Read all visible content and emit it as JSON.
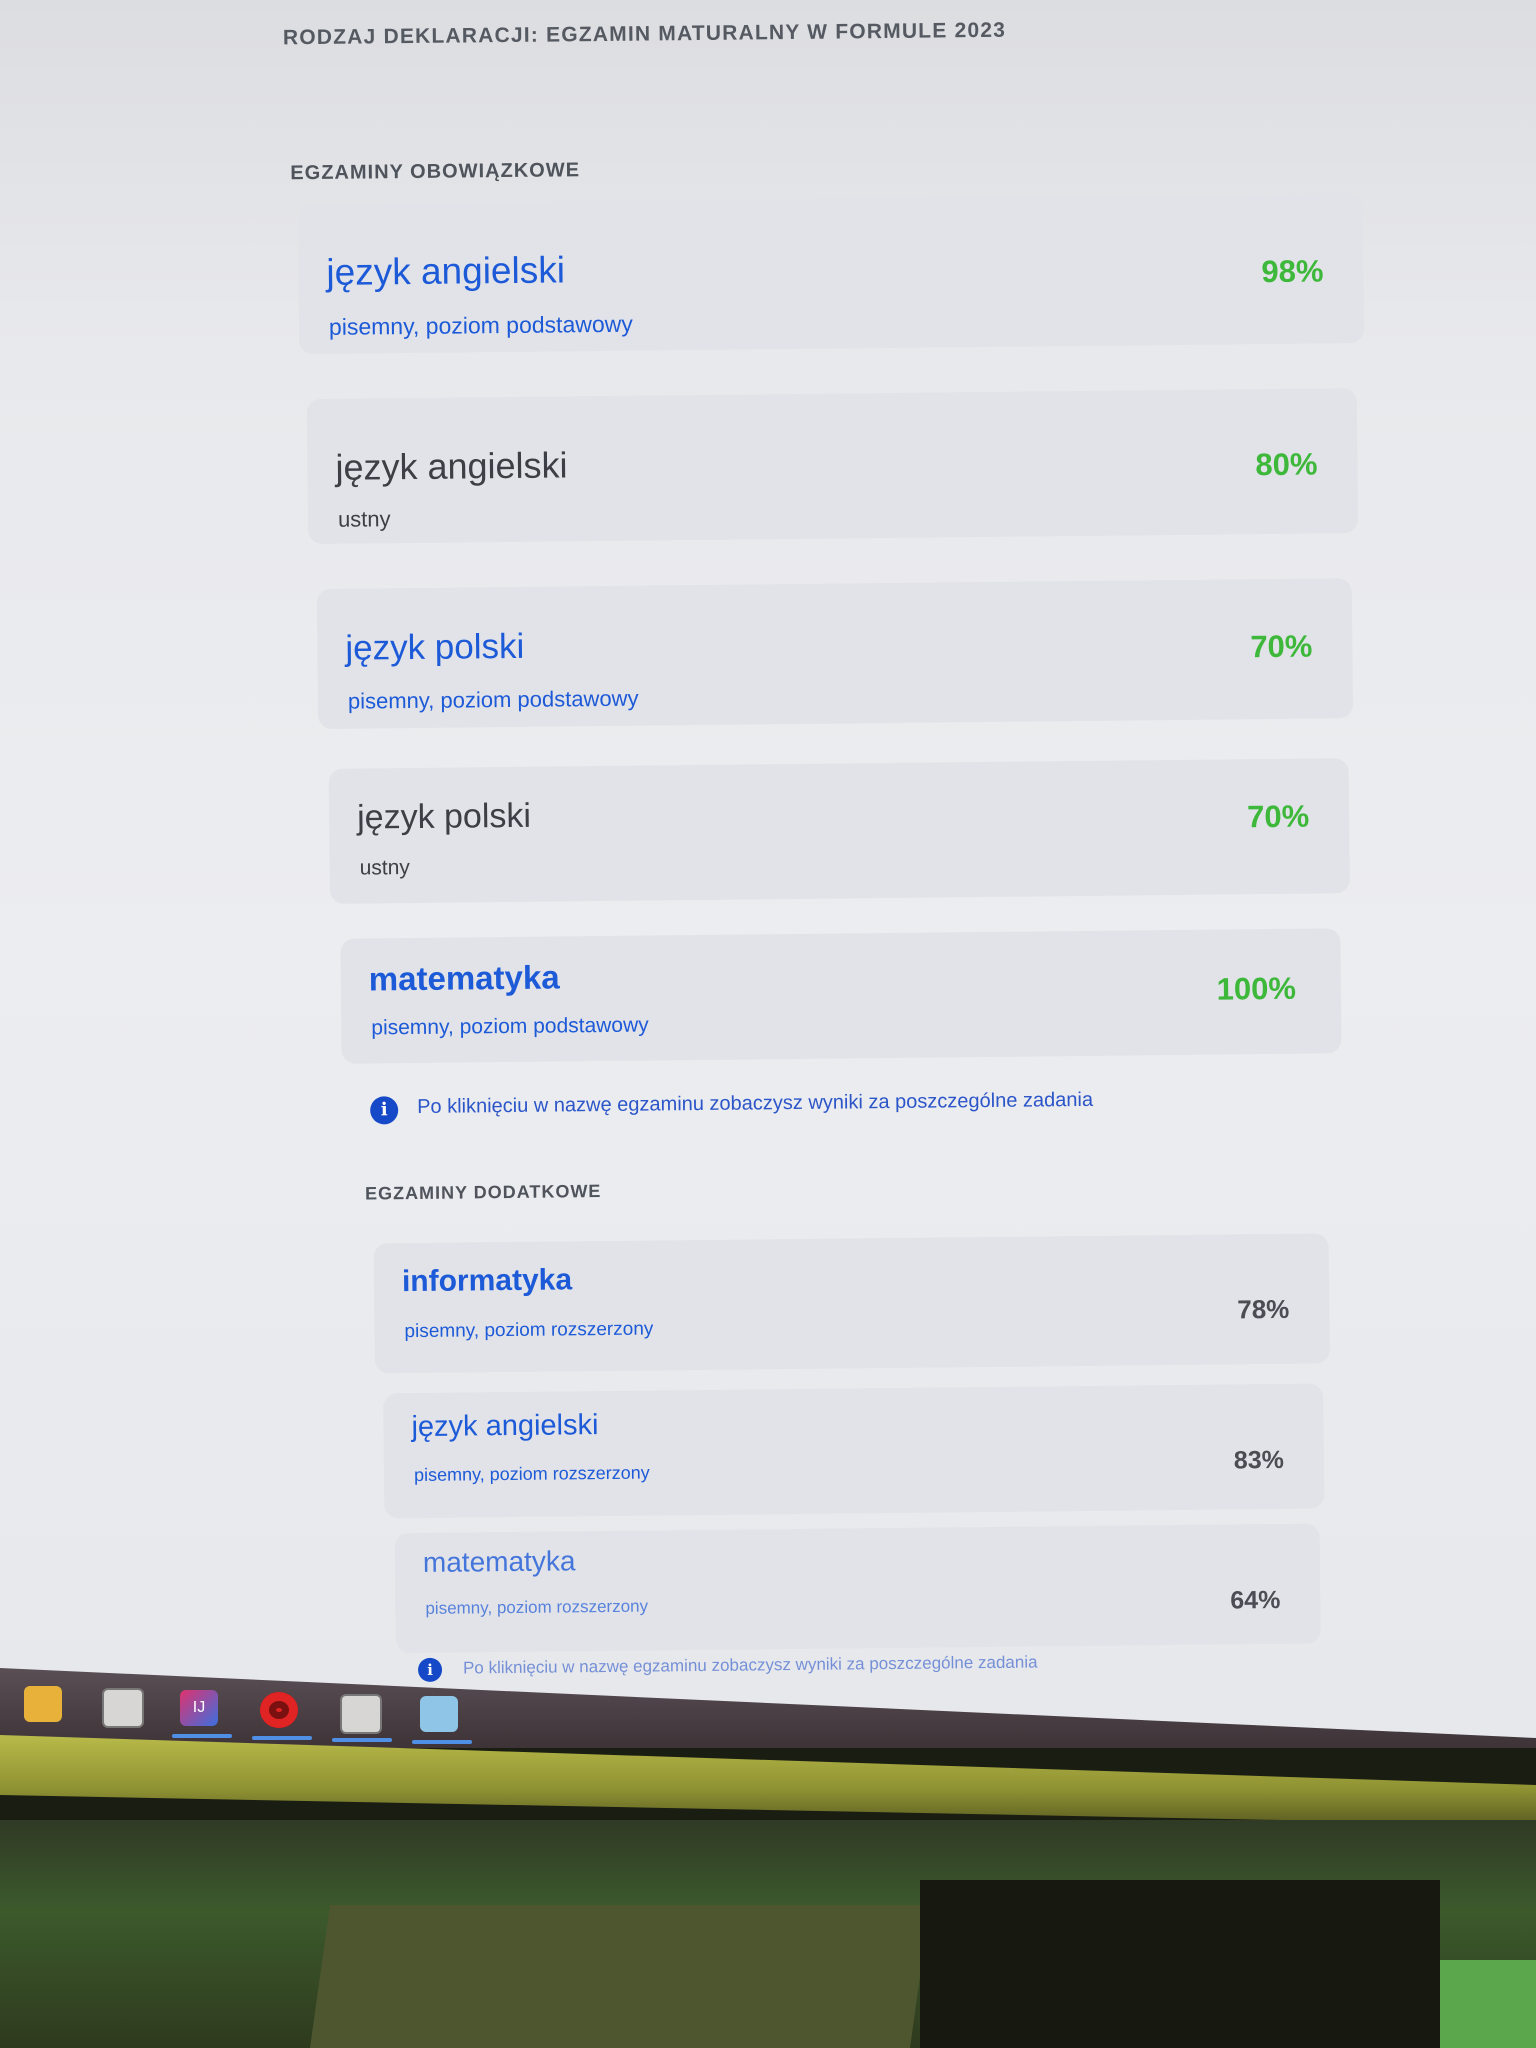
{
  "declaration_title": "RODZAJ DEKLARACJI: EGZAMIN MATURALNY W FORMULE 2023",
  "mandatory": {
    "title": "EGZAMINY OBOWIĄZKOWE",
    "exams": [
      {
        "name": "język angielski",
        "subtitle": "pisemny, poziom podstawowy",
        "score": "98%"
      },
      {
        "name": "język angielski",
        "subtitle": "ustny",
        "score": "80%"
      },
      {
        "name": "język polski",
        "subtitle": "pisemny, poziom podstawowy",
        "score": "70%"
      },
      {
        "name": "język polski",
        "subtitle": "ustny",
        "score": "70%"
      },
      {
        "name": "matematyka",
        "subtitle": "pisemny, poziom podstawowy",
        "score": "100%"
      }
    ],
    "note": "Po kliknięciu w nazwę egzaminu zobaczysz wyniki za poszczególne zadania"
  },
  "additional": {
    "title": "EGZAMINY DODATKOWE",
    "exams": [
      {
        "name": "informatyka",
        "subtitle": "pisemny, poziom rozszerzony",
        "score": "78%"
      },
      {
        "name": "język angielski",
        "subtitle": "pisemny, poziom rozszerzony",
        "score": "83%"
      },
      {
        "name": "matematyka",
        "subtitle": "pisemny, poziom rozszerzony",
        "score": "64%"
      }
    ],
    "note": "Po kliknięciu w nazwę egzaminu zobaczysz wyniki za poszczególne zadania"
  },
  "icons": {
    "info": "info-icon",
    "taskbar": [
      "file-explorer-icon",
      "notion-icon",
      "intellij-icon",
      "opera-icon",
      "notion-icon",
      "notepad-icon"
    ]
  },
  "colors": {
    "link_blue": "#1d5ad8",
    "score_green": "#3db83a",
    "score_gray": "#4a4d53",
    "info_blue": "#1549c7"
  }
}
